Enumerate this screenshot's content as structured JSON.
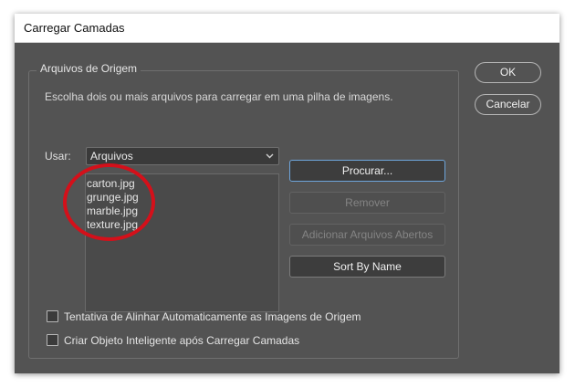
{
  "window": {
    "title": "Carregar Camadas"
  },
  "source_group": {
    "legend": "Arquivos de Origem",
    "description": "Escolha dois ou mais arquivos para carregar em uma pilha de imagens.",
    "use_label": "Usar:",
    "use_select_value": "Arquivos",
    "files": [
      "carton.jpg",
      "grunge.jpg",
      "marble.jpg",
      "texture.jpg"
    ],
    "buttons": {
      "browse": "Procurar...",
      "remove": "Remover",
      "add_open": "Adicionar Arquivos Abertos",
      "sort": "Sort By Name"
    }
  },
  "options": {
    "auto_align": {
      "label": "Tentativa de Alinhar Automaticamente as Imagens de Origem",
      "checked": false
    },
    "smart_object": {
      "label": "Criar Objeto Inteligente após Carregar Camadas",
      "checked": false
    }
  },
  "dialog_buttons": {
    "ok": "OK",
    "cancel": "Cancelar"
  },
  "colors": {
    "dialog_bg": "#535353",
    "annotation_ring": "#d4101a",
    "focus_border": "#6ea6dc"
  }
}
